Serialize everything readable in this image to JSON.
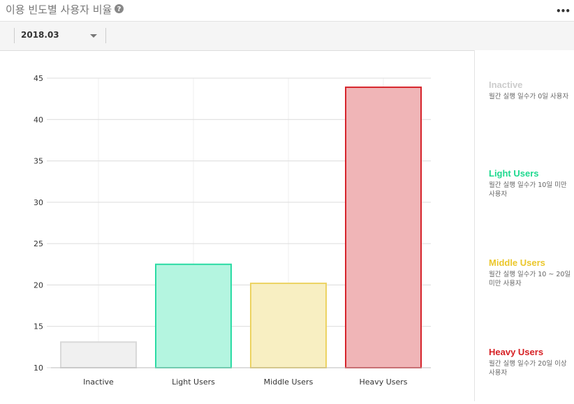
{
  "page": {
    "title": "이용 빈도별 사용자 비율",
    "help_icon": "question-circle-icon",
    "more_icon": "more-dots-icon"
  },
  "filter": {
    "selected_month": "2018.03",
    "dropdown_icon": "chevron-down-icon"
  },
  "chart_data": {
    "type": "bar",
    "categories": [
      "Inactive",
      "Light Users",
      "Middle Users",
      "Heavy Users"
    ],
    "values": [
      13.1,
      22.5,
      20.2,
      43.9
    ],
    "ylim": [
      10,
      45
    ],
    "yticks": [
      10,
      15,
      20,
      25,
      30,
      35,
      40,
      45
    ],
    "grid": true,
    "title": "",
    "xlabel": "",
    "ylabel": "",
    "colors": {
      "fill": [
        "#f0f0f0",
        "#b4f5e0",
        "#f8efc2",
        "#f0b5b7"
      ],
      "stroke": [
        "#d9d9d9",
        "#2bdba4",
        "#ecd362",
        "#d6252c"
      ]
    }
  },
  "legend": [
    {
      "name": "Inactive",
      "desc": "월간 실행 일수가 0일 사용자",
      "color": "#cccccc"
    },
    {
      "name": "Light Users",
      "desc": "월간 실행 일수가 10일 미만 사용자",
      "color": "#1ed98f"
    },
    {
      "name": "Middle Users",
      "desc": "월간 실행 일수가 10 ~ 20일 미만 사용자",
      "color": "#ebc72b"
    },
    {
      "name": "Heavy Users",
      "desc": "월간 실행 일수가 20일 이상 사용자",
      "color": "#d62024"
    }
  ]
}
